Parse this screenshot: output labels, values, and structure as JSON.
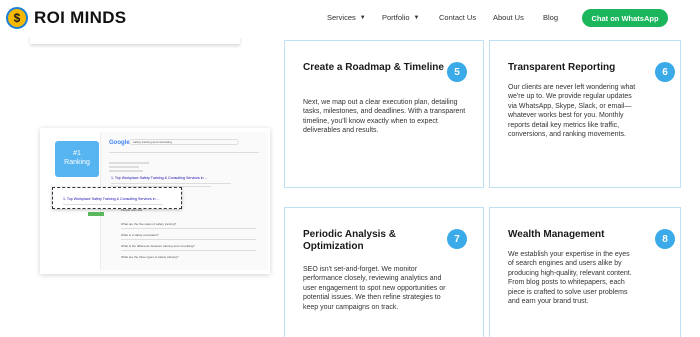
{
  "brand": {
    "initial": "$",
    "name": "ROI MINDS"
  },
  "nav": {
    "items": [
      {
        "label": "Services",
        "has_dropdown": true
      },
      {
        "label": "Portfolio",
        "has_dropdown": true
      },
      {
        "label": "Contact Us",
        "has_dropdown": false
      },
      {
        "label": "About Us",
        "has_dropdown": false
      },
      {
        "label": "Blog",
        "has_dropdown": false
      }
    ],
    "cta_label": "Chat on WhatsApp"
  },
  "serp_image": {
    "badge": "#1\nRanking",
    "search_logo": "Google",
    "search_query": "safety training and consulting",
    "result_title": "1. Top Workplace Safety Training & Consulting Services in ...",
    "highlight_title": "1. Top Workplace Safety Training & Consulting Services in ...",
    "paa_heading": "People also ask",
    "questions": [
      "What are the five steps of safety training?",
      "What is a safety consultant?",
      "What is the difference between training and consulting?",
      "What are the three types of safety training?"
    ]
  },
  "cards": [
    {
      "number": "5",
      "title": "Create a Roadmap & Timeline",
      "body": "Next, we map out a clear execution plan, detailing tasks, milestones, and deadlines. With a transparent timeline, you'll know exactly when to expect deliverables and results."
    },
    {
      "number": "6",
      "title": "Transparent Reporting",
      "body": "Our clients are never left wondering what we're up to. We provide regular updates via WhatsApp, Skype, Slack, or email—whatever works best for you. Monthly reports detail key metrics like traffic, conversions, and ranking movements."
    },
    {
      "number": "7",
      "title": "Periodic Analysis & Optimization",
      "body": "SEO isn't set-and-forget. We monitor performance closely, reviewing analytics and user engagement to spot new opportunities or potential issues. We then refine strategies to keep your campaigns on track."
    },
    {
      "number": "8",
      "title": "Wealth Management",
      "body": "We establish your expertise in the eyes of search engines and users alike by producing high-quality, relevant content. From blog posts to whitepapers, each piece is crafted to solve user problems and earn your brand trust."
    }
  ],
  "colors": {
    "accent": "#3aaae8",
    "cta": "#1bb55c",
    "card_border": "#bfe0f5",
    "logo_gold": "#f5b800"
  }
}
